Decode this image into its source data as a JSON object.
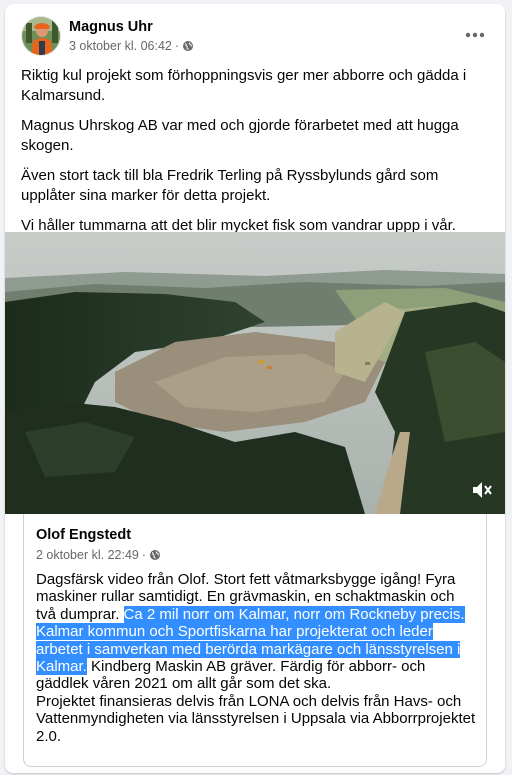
{
  "post": {
    "author": "Magnus Uhr",
    "date": "3 oktober kl. 06:42",
    "separator": "·",
    "more_label": "•••",
    "paragraphs": [
      "Riktig kul projekt som förhoppningsvis ger mer abborre och gädda i Kalmarsund.",
      "Magnus Uhrskog AB var med och gjorde förarbetet med att hugga skogen.",
      "Även stort tack till bla Fredrik Terling på Ryssbylunds gård som upplåter sina marker för detta projekt.",
      "Vi håller tummarna att det blir mycket fisk som vandrar uppp i vår."
    ]
  },
  "video": {
    "mute_icon": "speaker-muted-icon"
  },
  "shared": {
    "author": "Olof Engstedt",
    "date": "2 oktober kl. 22:49",
    "separator": "·",
    "text_before": "Dagsfärsk video från Olof. Stort fett våtmarksbygge igång! Fyra maskiner rullar samtidigt. En grävmaskin, en schaktmaskin och två dumprar. ",
    "text_selected": "Ca 2 mil norr om Kalmar, norr om Rockneby precis. Kalmar kommun och Sportfiskarna har projekterat och leder arbetet i samverkan med berörda markägare och länsstyrelsen i Kalmar.",
    "text_after": " Kindberg Maskin AB gräver. Färdig för abborr- och gäddlek våren 2021 om allt går som det ska.",
    "text_line2": "Projektet finansieras delvis från LONA och delvis från Havs- och Vattenmyndigheten via länsstyrelsen i Uppsala via Abborrprojektet 2.0."
  },
  "colors": {
    "background": "#f0f2f5",
    "card": "#ffffff",
    "text": "#050505",
    "secondary_text": "#65676b",
    "selection": "#338fff"
  }
}
